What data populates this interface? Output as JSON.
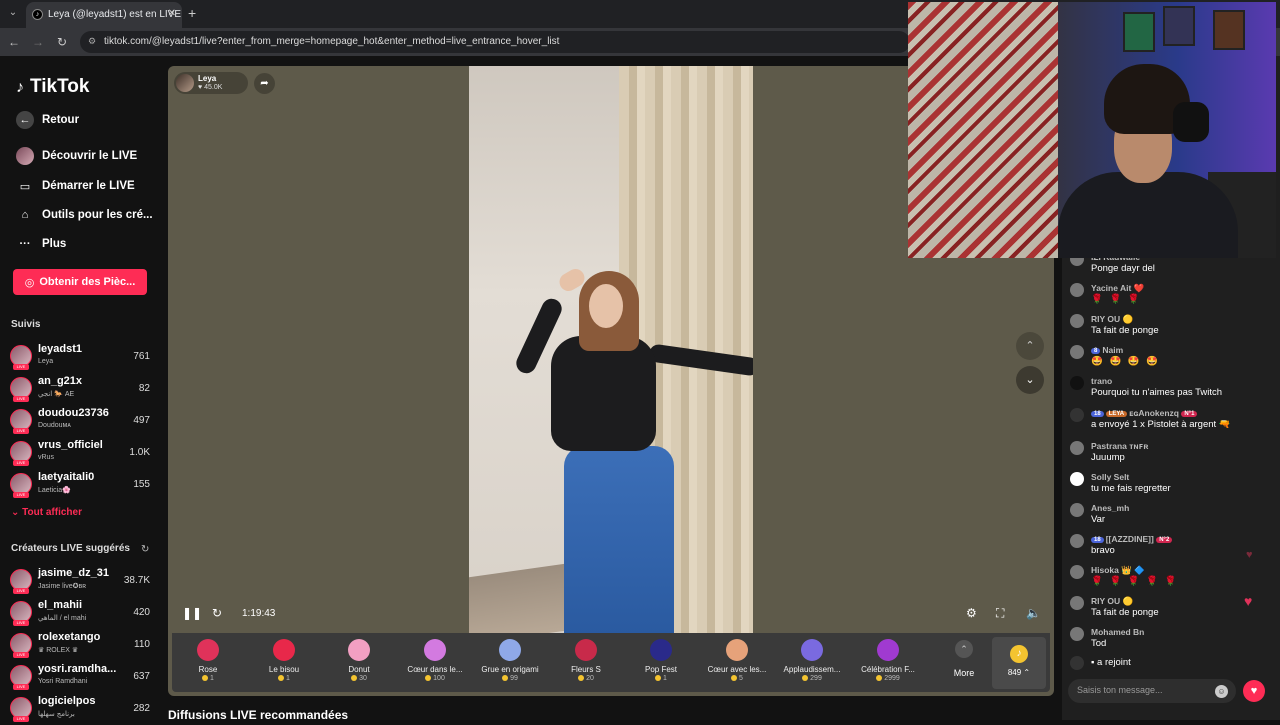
{
  "browser": {
    "tab_title": "Leya (@leyadst1) est en LIVE",
    "url": "tiktok.com/@leyadst1/live?enter_from_merge=homepage_hot&enter_method=live_entrance_hover_list"
  },
  "sidebar": {
    "logo": "TikTok",
    "back_label": "Retour",
    "nav": [
      {
        "label": "Découvrir le LIVE",
        "icon": "live-avatar-icon"
      },
      {
        "label": "Démarrer le LIVE",
        "icon": "camera-icon"
      },
      {
        "label": "Outils pour les cré...",
        "icon": "home-icon"
      },
      {
        "label": "Plus",
        "icon": "more-icon"
      }
    ],
    "coins_button": "Obtenir des Pièc...",
    "following_title": "Suivis",
    "following": [
      {
        "name": "leyadst1",
        "sub": "Leya",
        "count": "761"
      },
      {
        "name": "an_g21x",
        "sub": "انجي 🐎 AE",
        "count": "82"
      },
      {
        "name": "doudou23736",
        "sub": "Doudouᴍᴀ",
        "count": "497"
      },
      {
        "name": "vrus_officiel",
        "sub": "vRus",
        "count": "1.0K"
      },
      {
        "name": "laetyaitali0",
        "sub": "Laeticia🌸",
        "count": "155"
      }
    ],
    "show_all": "Tout afficher",
    "suggested_title": "Créateurs LIVE suggérés",
    "suggested": [
      {
        "name": "jasime_dz_31",
        "sub": "Jasime live✪ʙʀ",
        "count": "38.7K"
      },
      {
        "name": "el_mahii",
        "sub": "الماهي / el mahi",
        "count": "420"
      },
      {
        "name": "rolexetango",
        "sub": "♛ ROLEX ♛",
        "count": "110"
      },
      {
        "name": "yosri.ramdha...",
        "sub": "Yosri Ramdhani",
        "count": "637"
      },
      {
        "name": "logicielpos",
        "sub": "برنامج سهلها",
        "count": "282"
      }
    ]
  },
  "player": {
    "host_name": "Leya",
    "host_viewers": "♥ 45.0K",
    "time": "1:19:43",
    "gifts": [
      {
        "name": "Rose",
        "price": "1",
        "color": "#e0325a"
      },
      {
        "name": "Le bisou",
        "price": "1",
        "color": "#e8284a"
      },
      {
        "name": "Donut",
        "price": "30",
        "color": "#f29fc2"
      },
      {
        "name": "Cœur dans le...",
        "price": "100",
        "color": "#d37ae0"
      },
      {
        "name": "Grue en origami",
        "price": "99",
        "color": "#8fa8e8"
      },
      {
        "name": "Fleurs S",
        "price": "20",
        "color": "#c82a4a"
      },
      {
        "name": "Pop Fest",
        "price": "1",
        "color": "#2a2a8a"
      },
      {
        "name": "Cœur avec les...",
        "price": "5",
        "color": "#e6a27a"
      },
      {
        "name": "Applaudissem...",
        "price": "299",
        "color": "#7a6ae0"
      },
      {
        "name": "Célébration F...",
        "price": "2999",
        "color": "#a03ad0"
      }
    ],
    "more_label": "More",
    "wallet_value": "849"
  },
  "recommended_title": "Diffusions LIVE recommandées",
  "chat": {
    "messages": [
      {
        "user": "IZI Kadwalle",
        "text": "Ponge dayr del"
      },
      {
        "user": "Yacine Ait ❤️",
        "text": "🌹 🌹 🌹"
      },
      {
        "user": "RIY OU 🟡",
        "text": "Ta fait de ponge"
      },
      {
        "user": "Naim",
        "badge": "8",
        "text": "🤩 🤩 🤩 🤩"
      },
      {
        "user": "trano",
        "text": "Pourquoi tu n'aimes pas Twitch"
      },
      {
        "user": "ᴇɢAnokenzq",
        "badge": "18",
        "badge2": "LEYA",
        "badge3": "N°1",
        "text": "a envoyé 1 x Pistolet à argent 🔫"
      },
      {
        "user": "Pastrana ᴛɴꜰʀ",
        "text": "Juuump"
      },
      {
        "user": "Solly Selt",
        "text": "tu me fais regretter"
      },
      {
        "user": "Anes_mh",
        "text": "Var"
      },
      {
        "user": "[[AZZDINE]]",
        "badge": "18",
        "badge3": "N°2",
        "text": "bravo"
      },
      {
        "user": "Hisoka 👑 🔷",
        "text": "🌹 🌹 🌹 🌹 🌹"
      },
      {
        "user": "RIY OU 🟡",
        "text": "Ta fait de ponge"
      },
      {
        "user": "Mohamed Bn",
        "text": "Tod"
      },
      {
        "user": "",
        "text": "a rejoint"
      }
    ],
    "input_placeholder": "Saisis ton message..."
  }
}
